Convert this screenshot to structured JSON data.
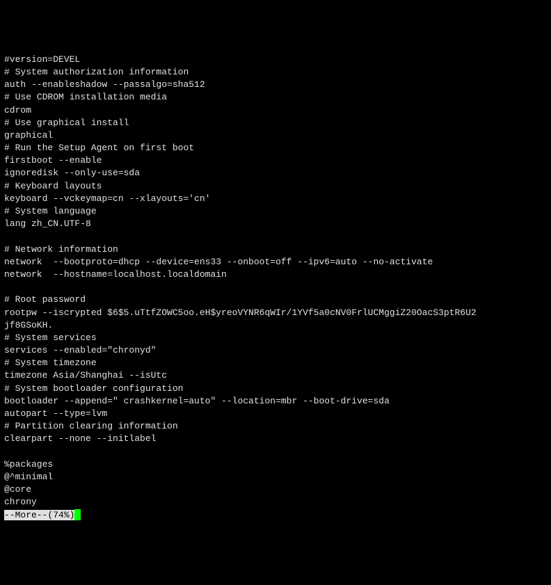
{
  "terminal": {
    "lines": [
      "#version=DEVEL",
      "# System authorization information",
      "auth --enableshadow --passalgo=sha512",
      "# Use CDROM installation media",
      "cdrom",
      "# Use graphical install",
      "graphical",
      "# Run the Setup Agent on first boot",
      "firstboot --enable",
      "ignoredisk --only-use=sda",
      "# Keyboard layouts",
      "keyboard --vckeymap=cn --xlayouts='cn'",
      "# System language",
      "lang zh_CN.UTF-8",
      "",
      "# Network information",
      "network  --bootproto=dhcp --device=ens33 --onboot=off --ipv6=auto --no-activate",
      "network  --hostname=localhost.localdomain",
      "",
      "# Root password",
      "rootpw --iscrypted $6$5.uTtfZOWC5oo.eH$yreoVYNR6qWIr/1YVf5a0cNV0FrlUCMggiZ20OacS3ptR6U2",
      "jf8GSoKH.",
      "# System services",
      "services --enabled=\"chronyd\"",
      "# System timezone",
      "timezone Asia/Shanghai --isUtc",
      "# System bootloader configuration",
      "bootloader --append=\" crashkernel=auto\" --location=mbr --boot-drive=sda",
      "autopart --type=lvm",
      "# Partition clearing information",
      "clearpart --none --initlabel",
      "",
      "%packages",
      "@^minimal",
      "@core",
      "chrony"
    ],
    "more_prompt": "--More--(74%)"
  }
}
